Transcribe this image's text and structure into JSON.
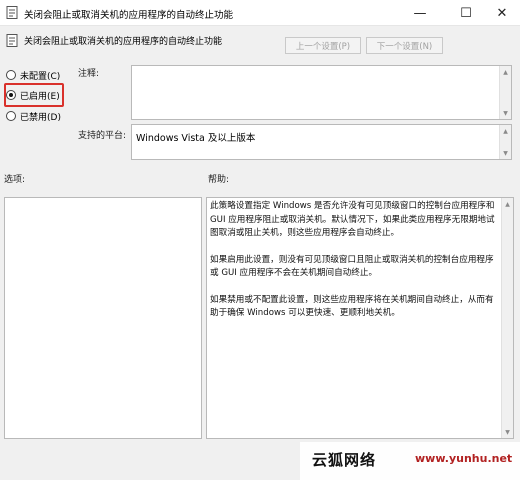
{
  "window": {
    "title": "关闭会阻止或取消关机的应用程序的自动终止功能",
    "controls": {
      "minimize": "—",
      "maximize": "☐",
      "close": "✕"
    }
  },
  "header": {
    "policy_name": "关闭会阻止或取消关机的应用程序的自动终止功能",
    "prev_button": "上一个设置(P)",
    "next_button": "下一个设置(N)"
  },
  "state": {
    "options": [
      {
        "label": "未配置(C)",
        "selected": false
      },
      {
        "label": "已启用(E)",
        "selected": true
      },
      {
        "label": "已禁用(D)",
        "selected": false
      }
    ]
  },
  "comment": {
    "label": "注释:",
    "value": ""
  },
  "platform": {
    "label": "支持的平台:",
    "value": "Windows Vista 及以上版本"
  },
  "options_section": {
    "label": "选项:"
  },
  "help_section": {
    "label": "帮助:",
    "paragraphs": [
      "此策略设置指定 Windows 是否允许没有可见顶级窗口的控制台应用程序和 GUI 应用程序阻止或取消关机。默认情况下，如果此类应用程序无限期地试图取消或阻止关机，则这些应用程序会自动终止。",
      "如果启用此设置，则没有可见顶级窗口且阻止或取消关机的控制台应用程序或 GUI 应用程序不会在关机期间自动终止。",
      "如果禁用或不配置此设置，则这些应用程序将在关机期间自动终止，从而有助于确保 Windows 可以更快速、更顺利地关机。"
    ]
  },
  "watermark": {
    "text": "云狐网络",
    "url": "www.yunhu.net"
  },
  "colors": {
    "highlight": "#d9312b",
    "background": "#f0f0f0"
  }
}
